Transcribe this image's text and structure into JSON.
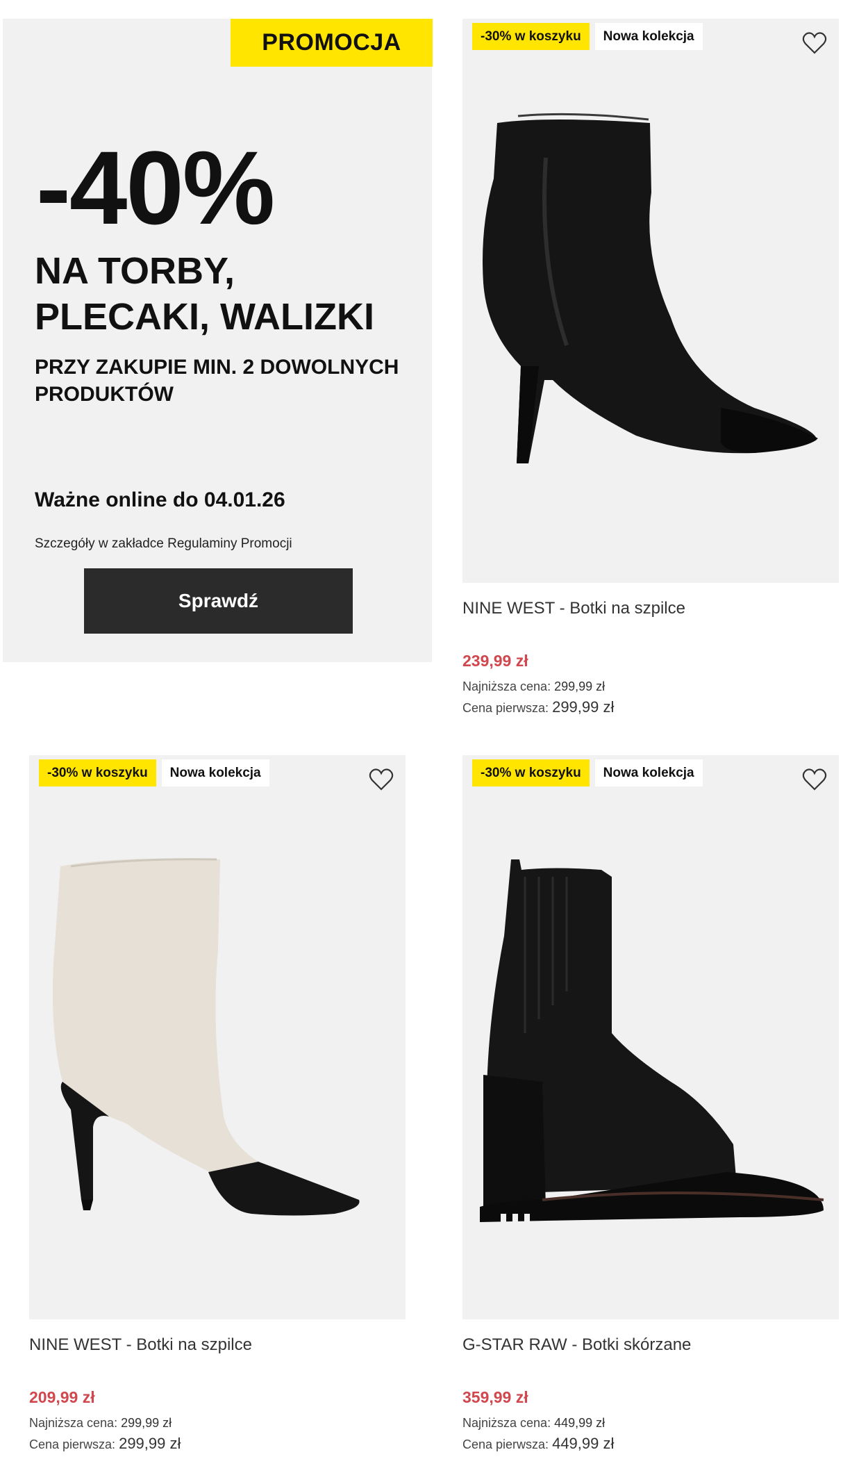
{
  "promo": {
    "tag": "PROMOCJA",
    "discount": "-40%",
    "headline": "NA TORBY,\nPLECAKI, WALIZKI",
    "subline": "PRZY ZAKUPIE MIN. 2 DOWOLNYCH PRODUKTÓW",
    "valid": "Ważne online do 04.01.26",
    "note": "Szczegóły w zakładce Regulaminy Promocji",
    "button": "Sprawdź"
  },
  "products": [
    {
      "badge_promo": "-30% w koszyku",
      "badge_new": "Nowa kolekcja",
      "name": "NINE WEST - Botki na szpilce",
      "price": "239,99 zł",
      "lowest_label": "Najniższa cena:",
      "lowest_value": "299,99 zł",
      "first_label": "Cena pierwsza:",
      "first_value": "299,99 zł",
      "icon": "heart-icon"
    },
    {
      "badge_promo": "-30% w koszyku",
      "badge_new": "Nowa kolekcja",
      "name": "NINE WEST - Botki na szpilce",
      "price": "209,99 zł",
      "lowest_label": "Najniższa cena:",
      "lowest_value": "299,99 zł",
      "first_label": "Cena pierwsza:",
      "first_value": "299,99 zł",
      "icon": "heart-icon"
    },
    {
      "badge_promo": "-30% w koszyku",
      "badge_new": "Nowa kolekcja",
      "name": "G-STAR RAW - Botki skórzane",
      "price": "359,99 zł",
      "lowest_label": "Najniższa cena:",
      "lowest_value": "449,99 zł",
      "first_label": "Cena pierwsza:",
      "first_value": "449,99 zł",
      "icon": "heart-icon"
    }
  ],
  "colors": {
    "accent_yellow": "#ffe500",
    "price_red": "#d0474e",
    "button_dark": "#2b2b2b",
    "card_bg": "#f1f1f1"
  }
}
